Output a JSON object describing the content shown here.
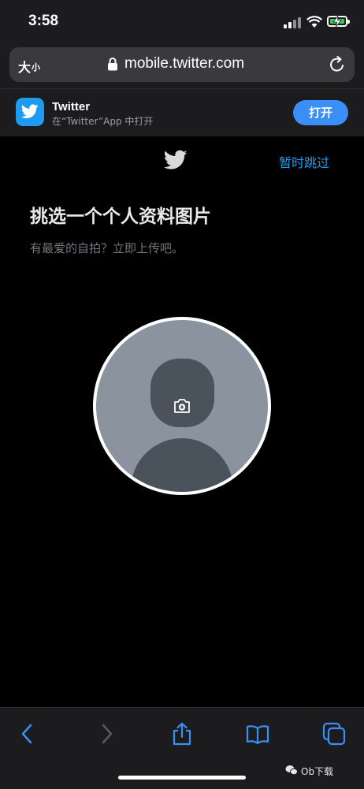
{
  "status_bar": {
    "time": "3:58"
  },
  "browser": {
    "text_size_big": "大",
    "text_size_small": "小",
    "url": "mobile.twitter.com"
  },
  "banner": {
    "app_name": "Twitter",
    "subtitle": "在“Twitter”App 中打开",
    "open_label": "打开"
  },
  "page": {
    "skip_label": "暂时跳过",
    "title": "挑选一个个人资料图片",
    "subtitle": "有最爱的自拍？立即上传吧。"
  },
  "watermark": "Ob下载",
  "colors": {
    "accent": "#1d9bf0",
    "open_button": "#3a8ff6",
    "battery": "#30d158",
    "background": "#000000",
    "chrome": "#1c1c1e"
  },
  "icons": [
    "back-icon",
    "forward-icon",
    "share-icon",
    "bookmarks-icon",
    "tabs-icon",
    "camera-plus-icon",
    "lock-icon",
    "reload-icon",
    "twitter-bird-icon"
  ]
}
